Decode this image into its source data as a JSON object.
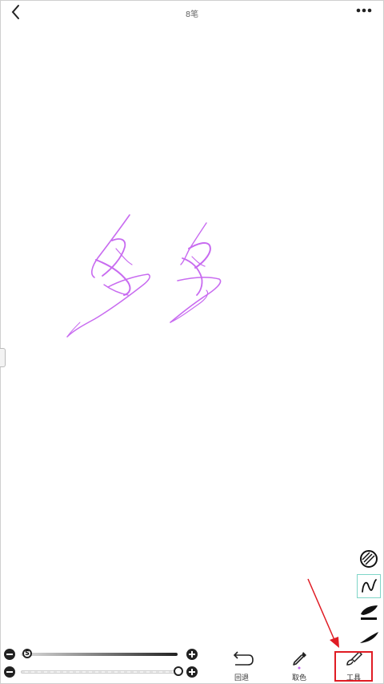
{
  "header": {
    "title": "8笔",
    "back_icon": "chevron-left-icon",
    "more_icon": "ellipsis-icon"
  },
  "canvas": {
    "stroke_color": "#c86bf0"
  },
  "side_tools": [
    {
      "icon": "eraser-hatch-icon"
    },
    {
      "icon": "pen-curve-icon",
      "selected": true
    },
    {
      "icon": "brush-tip-icon"
    },
    {
      "icon": "calligraphy-tip-icon"
    }
  ],
  "sliders": {
    "size": {
      "value_fraction": 0.03,
      "thumb_glyph": "S"
    },
    "opacity": {
      "value_fraction": 1.0
    }
  },
  "toolbar": {
    "undo_label": "回退",
    "color_pick_label": "取色",
    "tools_label": "工具"
  },
  "colors": {
    "accent_selected": "#7fd6c8",
    "highlight": "#e01c24",
    "ink": "#c86bf0"
  }
}
